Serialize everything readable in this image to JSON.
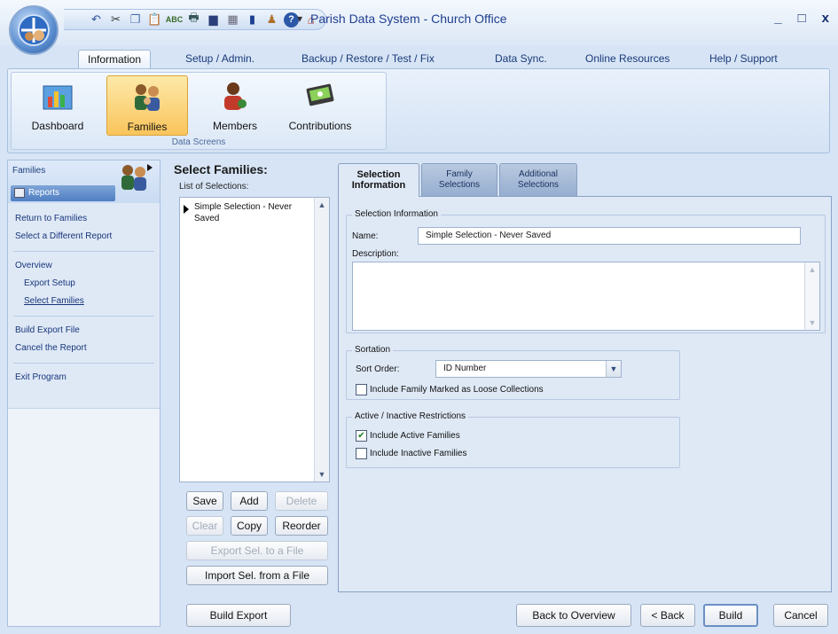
{
  "app": {
    "title": "Parish Data System - Church Office",
    "window_controls": {
      "minimize": "_",
      "maximize": "□",
      "close": "x"
    }
  },
  "ribbon": {
    "tabs": [
      {
        "label": "Information",
        "active": true
      },
      {
        "label": "Setup / Admin."
      },
      {
        "label": "Backup / Restore / Test / Fix"
      },
      {
        "label": "Data Sync."
      },
      {
        "label": "Online Resources"
      },
      {
        "label": "Help / Support"
      }
    ],
    "group_label": "Data Screens",
    "buttons": [
      {
        "label": "Dashboard",
        "icon": "dashboard-chart-icon"
      },
      {
        "label": "Families",
        "icon": "family-people-icon",
        "active": true
      },
      {
        "label": "Members",
        "icon": "member-person-icon"
      },
      {
        "label": "Contributions",
        "icon": "contribution-card-icon"
      }
    ]
  },
  "leftnav": {
    "title": "Families",
    "reports_label": "Reports",
    "links": {
      "return": "Return to Families",
      "different": "Select a Different Report",
      "overview": "Overview",
      "export_setup": "Export Setup",
      "select_families": "Select Families",
      "build_export": "Build Export File",
      "cancel_report": "Cancel the Report",
      "exit": "Exit Program"
    }
  },
  "selections": {
    "title": "Select Families:",
    "list_label": "List of Selections:",
    "items": [
      "Simple Selection - Never Saved"
    ],
    "buttons": {
      "save": "Save",
      "add": "Add",
      "delete": "Delete",
      "clear": "Clear",
      "copy": "Copy",
      "reorder": "Reorder",
      "export_sel": "Export Sel. to a File",
      "import_sel": "Import  Sel. from a File"
    }
  },
  "tabs": {
    "selection_info_1": "Selection",
    "selection_info_2": "Information",
    "family_sel_1": "Family",
    "family_sel_2": "Selections",
    "additional_sel_1": "Additional",
    "additional_sel_2": "Selections"
  },
  "selection_info": {
    "group_title": "Selection Information",
    "name_label": "Name:",
    "name_value": "Simple Selection - Never Saved",
    "description_label": "Description:",
    "description_value": ""
  },
  "sortation": {
    "group_title": "Sortation",
    "sort_order_label": "Sort Order:",
    "sort_order_value": "ID Number",
    "loose_label": "Include Family Marked as Loose Collections",
    "loose_checked": false
  },
  "restrictions": {
    "group_title": "Active / Inactive Restrictions",
    "active_label": "Include Active Families",
    "active_checked": true,
    "inactive_label": "Include Inactive Families",
    "inactive_checked": false
  },
  "footer": {
    "build_export": "Build Export",
    "back_to_overview": "Back to Overview",
    "back": "< Back",
    "build": "Build",
    "cancel": "Cancel"
  }
}
